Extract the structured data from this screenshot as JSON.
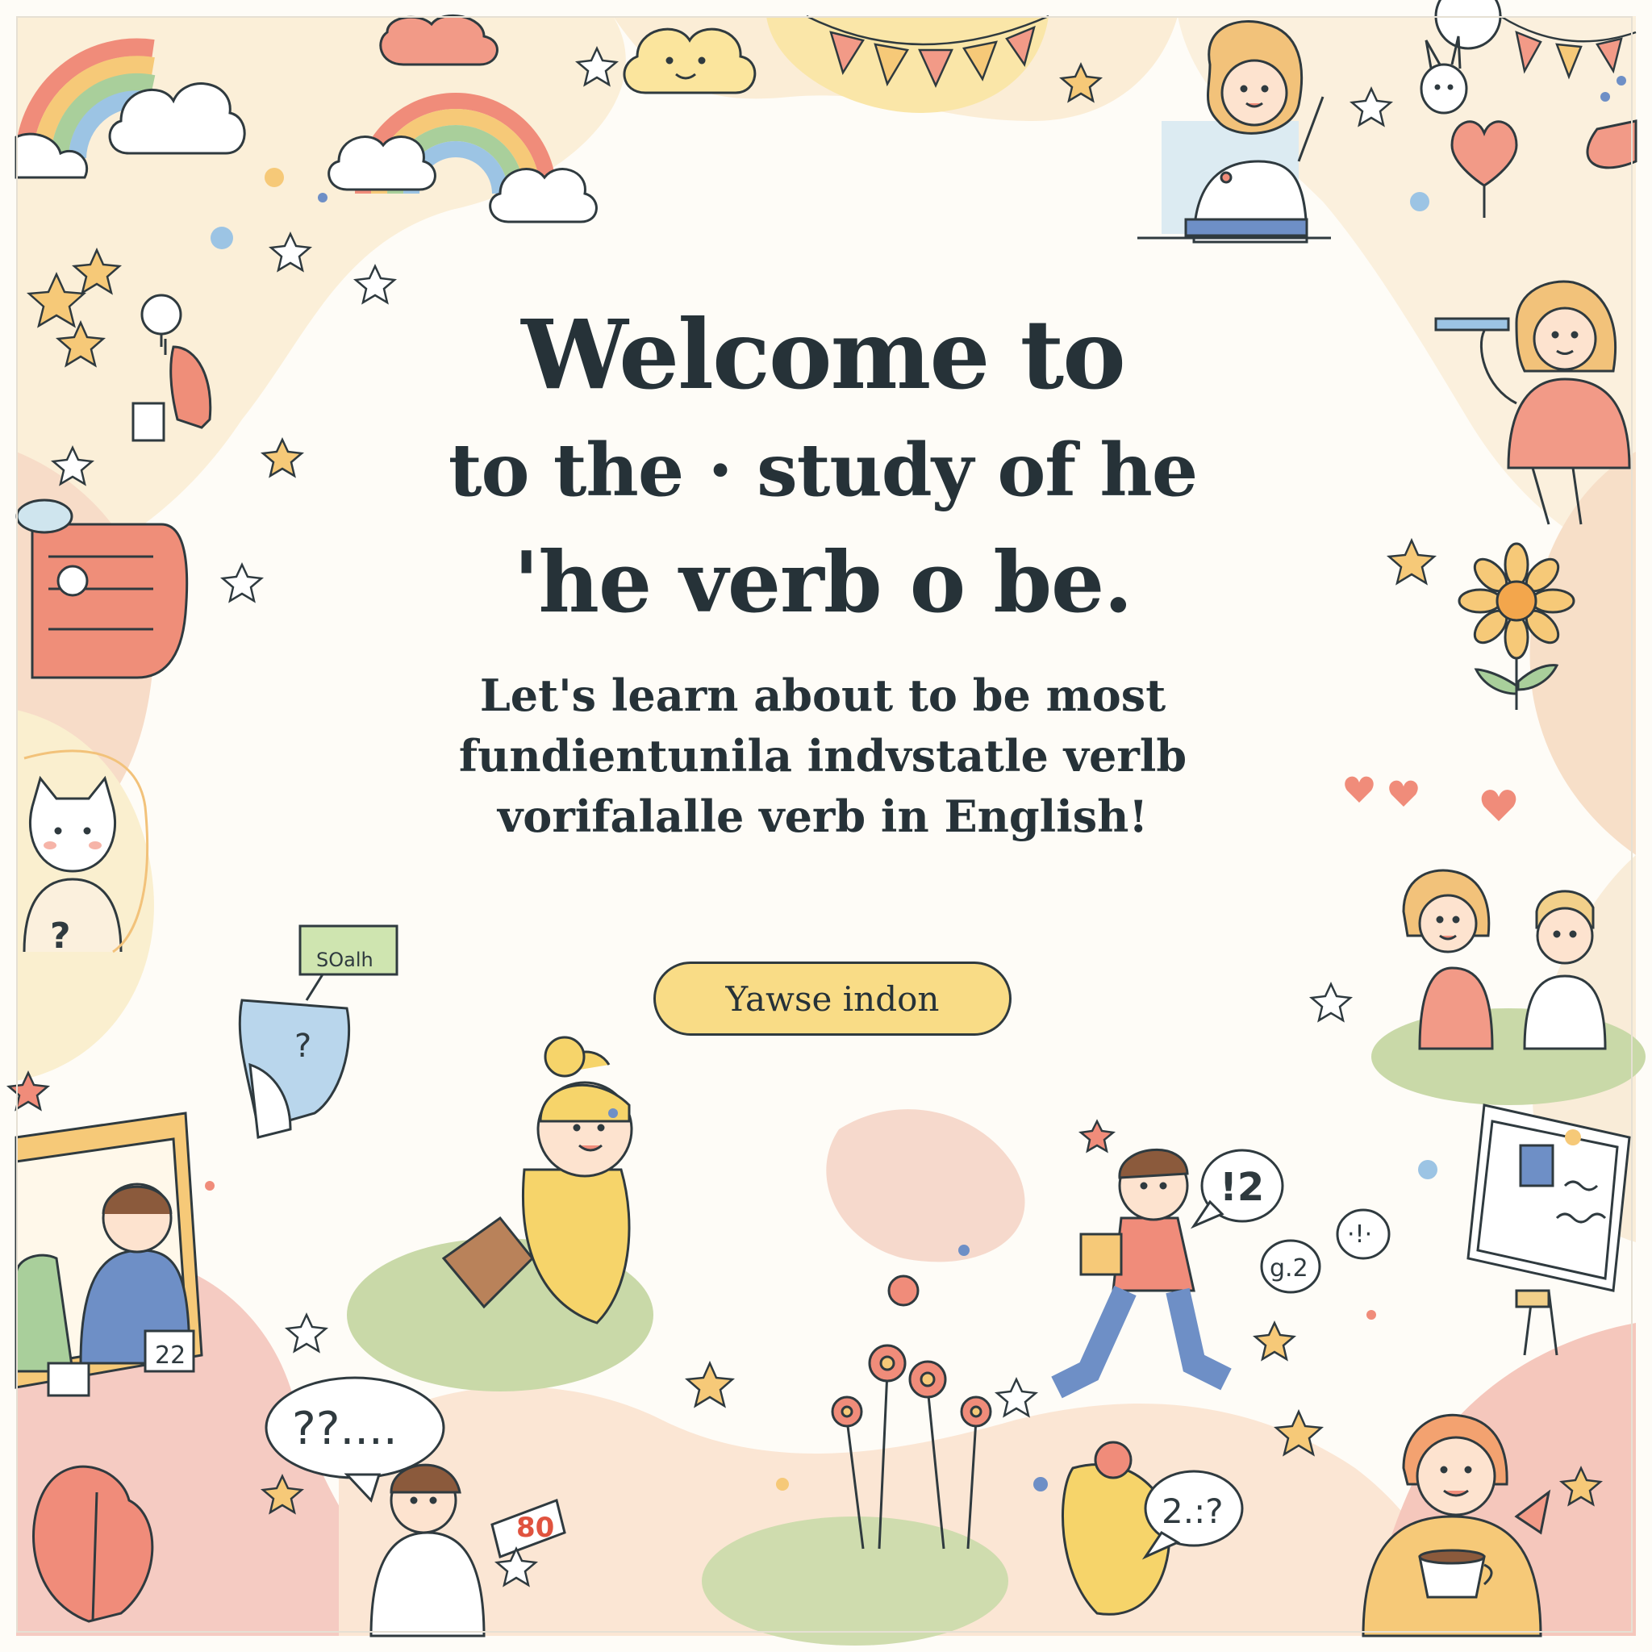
{
  "heading": {
    "line1": "Welcome to",
    "line2": "to the · study  of he",
    "line3": "'he verb o be."
  },
  "intro": {
    "line1": "Let's learn about to be most",
    "line2": "fundientunila indvstatle verlb",
    "line3": "vorifalalle verb in English!"
  },
  "cta": {
    "label": "Yawse indon"
  },
  "doodles": {
    "sign_label": "SOalh",
    "bubble_left": "??....",
    "bubble_right": "2.:?",
    "bubble_numbers": "!2",
    "bubble_small_a": "g.2",
    "bubble_small_b": "·!·",
    "frame_note": "22",
    "board_number": "80",
    "question_mark": "?"
  },
  "colors": {
    "text": "#263238",
    "button": "#f9dc86",
    "blob_peach": "#f6d8c2",
    "blob_pink": "#f3c6bd",
    "blob_yellow": "#faeab3",
    "blob_green": "#c9d9a8",
    "blob_cream": "#fbf1dd"
  },
  "icons": [
    "rainbow-icon",
    "cloud-icon",
    "star-icon",
    "heart-icon",
    "sunflower-icon",
    "flower-icon",
    "balloon-icon",
    "bunting-icon",
    "speech-bubble-icon",
    "whiteboard-icon",
    "book-icon",
    "backpack-icon",
    "coffee-cup-icon",
    "leaf-icon"
  ]
}
